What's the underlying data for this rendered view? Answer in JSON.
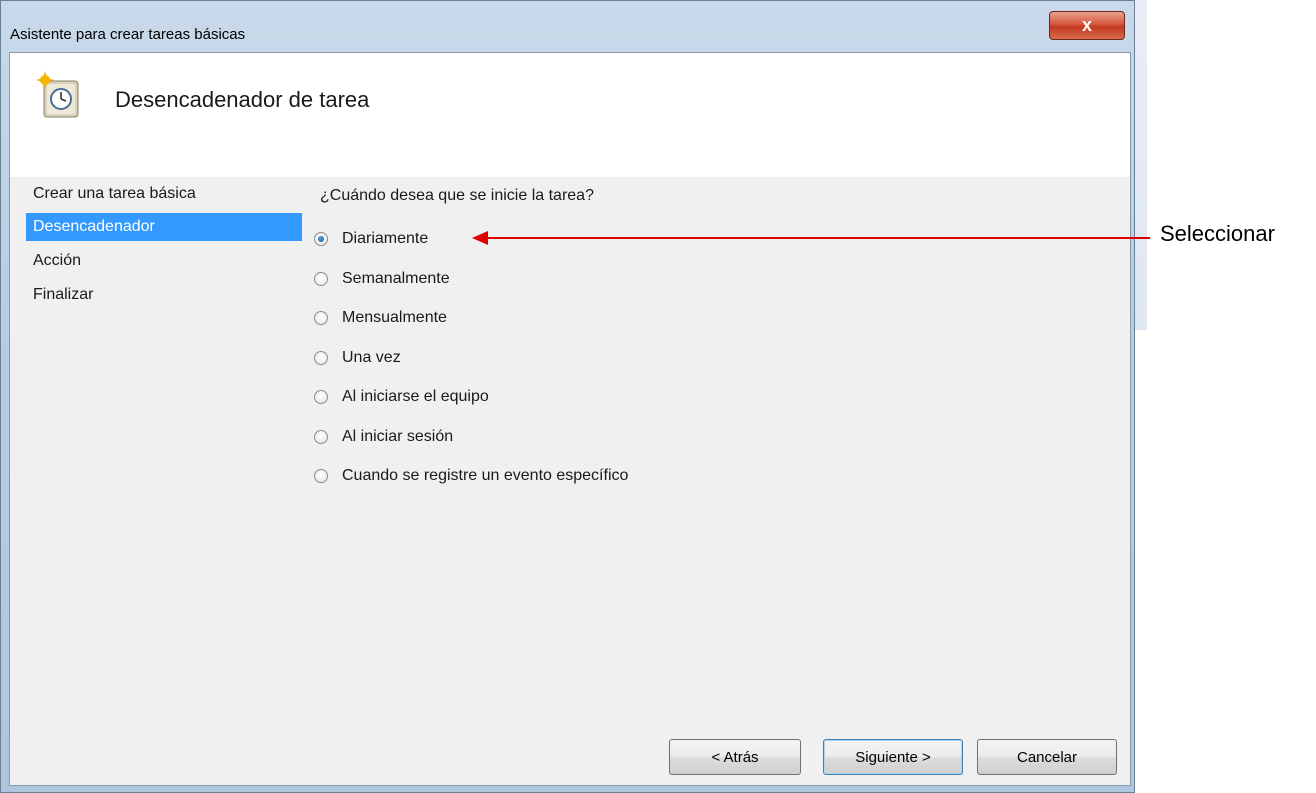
{
  "window": {
    "title": "Asistente para crear tareas básicas",
    "close_label": "x"
  },
  "header": {
    "title": "Desencadenador de tarea",
    "icon": "task-scheduler-clock-icon"
  },
  "sidebar": {
    "items": [
      {
        "label": "Crear una tarea básica",
        "active": false
      },
      {
        "label": "Desencadenador",
        "active": true
      },
      {
        "label": "Acción",
        "active": false
      },
      {
        "label": "Finalizar",
        "active": false
      }
    ]
  },
  "main": {
    "question": "¿Cuándo desea que se inicie la tarea?",
    "options": [
      {
        "label": "Diariamente",
        "checked": true
      },
      {
        "label": "Semanalmente",
        "checked": false
      },
      {
        "label": "Mensualmente",
        "checked": false
      },
      {
        "label": "Una vez",
        "checked": false
      },
      {
        "label": "Al iniciarse el equipo",
        "checked": false
      },
      {
        "label": "Al iniciar sesión",
        "checked": false
      },
      {
        "label": "Cuando se registre un evento específico",
        "checked": false
      }
    ]
  },
  "buttons": {
    "back": "< Atrás",
    "next": "Siguiente >",
    "cancel": "Cancelar"
  },
  "annotation": {
    "label": "Seleccionar",
    "color": "#e00000"
  }
}
